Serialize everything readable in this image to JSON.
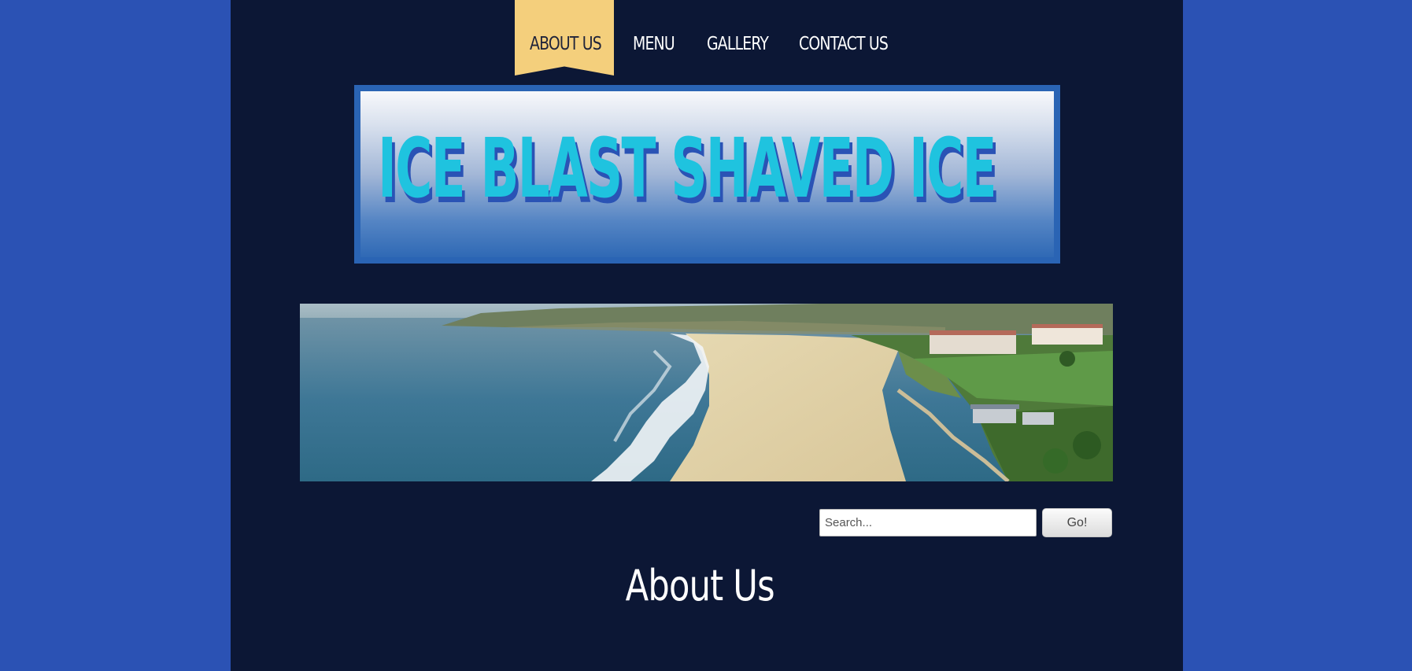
{
  "nav": {
    "items": [
      {
        "label": "ABOUT US",
        "active": true
      },
      {
        "label": "MENU",
        "active": false
      },
      {
        "label": "GALLERY",
        "active": false
      },
      {
        "label": "CONTACT US",
        "active": false
      }
    ]
  },
  "logo": {
    "text": "ICE BLAST SHAVED ICE"
  },
  "search": {
    "placeholder": "Search...",
    "value": "",
    "button_label": "Go!"
  },
  "main": {
    "title": "About Us"
  },
  "colors": {
    "outer_background": "#2b52b4",
    "page_background": "#0c1735",
    "nav_active": "#f4cf7c",
    "logo_text": "#1fc3df",
    "logo_frame": "#2a64b4"
  }
}
